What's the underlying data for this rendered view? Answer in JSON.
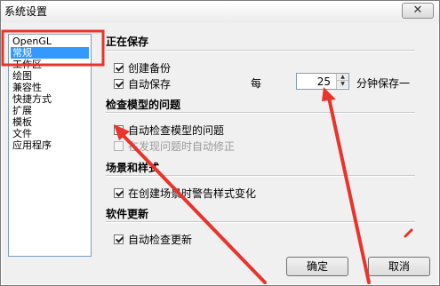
{
  "window": {
    "title": "系统设置",
    "close_glyph": "✕"
  },
  "sidebar": {
    "items": [
      {
        "label": "OpenGL",
        "selected": false
      },
      {
        "label": "常规",
        "selected": true
      },
      {
        "label": "工作区",
        "selected": false
      },
      {
        "label": "绘图",
        "selected": false
      },
      {
        "label": "兼容性",
        "selected": false
      },
      {
        "label": "快捷方式",
        "selected": false
      },
      {
        "label": "扩展",
        "selected": false
      },
      {
        "label": "模板",
        "selected": false
      },
      {
        "label": "文件",
        "selected": false
      },
      {
        "label": "应用程序",
        "selected": false
      }
    ]
  },
  "saving": {
    "title": "正在保存",
    "create_backup": {
      "label": "创建备份",
      "checked": true
    },
    "autosave": {
      "label": "自动保存",
      "checked": true
    },
    "every_label": "每",
    "interval_value": "25",
    "minutes_label": "分钟保存一"
  },
  "model_check": {
    "title": "检查模型的问题",
    "auto_check": {
      "label": "自动检查模型的问题",
      "checked": false
    },
    "auto_fix": {
      "label": "在发现问题时自动修正",
      "checked": false,
      "enabled": false
    }
  },
  "scenes": {
    "title": "场景和样式",
    "warn_style_change": {
      "label": "在创建场景时警告样式变化",
      "checked": true
    }
  },
  "updates": {
    "title": "软件更新",
    "auto_check_updates": {
      "label": "自动检查更新",
      "checked": true
    }
  },
  "buttons": {
    "ok": "确定",
    "cancel": "取消"
  },
  "annotation_color": "#e8342c"
}
